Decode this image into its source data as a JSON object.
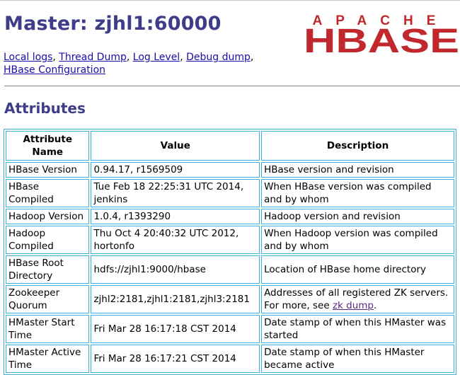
{
  "header": {
    "title": "Master: zjhl1:60000",
    "logo": {
      "top_text": "APACHE",
      "main_text": "HBASE"
    }
  },
  "nav_links": [
    "Local logs",
    "Thread Dump",
    "Log Level",
    "Debug dump",
    "HBase Configuration"
  ],
  "section": {
    "title": "Attributes"
  },
  "table": {
    "headers": [
      "Attribute Name",
      "Value",
      "Description"
    ],
    "rows": [
      [
        "HBase Version",
        "0.94.17, r1569509",
        "HBase version and revision"
      ],
      [
        "HBase Compiled",
        "Tue Feb 18 22:25:31 UTC 2014, jenkins",
        "When HBase version was compiled and by whom"
      ],
      [
        "Hadoop Version",
        "1.0.4, r1393290",
        "Hadoop version and revision"
      ],
      [
        "Hadoop Compiled",
        "Thu Oct 4 20:40:32 UTC 2012, hortonfo",
        "When Hadoop version was compiled and by whom"
      ],
      [
        "HBase Root Directory",
        "hdfs://zjhl1:9000/hbase",
        "Location of HBase home directory"
      ],
      [
        "Zookeeper Quorum",
        "zjhl2:2181,zjhl1:2181,zjhl3:2181",
        "Addresses of all registered ZK servers. For more, see "
      ],
      [
        "HMaster Start Time",
        "Fri Mar 28 16:17:18 CST 2014",
        "Date stamp of when this HMaster was started"
      ],
      [
        "HMaster Active Time",
        "Fri Mar 28 16:17:21 CST 2014",
        "Date stamp of when this HMaster became active"
      ]
    ],
    "zk_link": "zk dump",
    "zk_suffix": "."
  },
  "colors": {
    "heading": "#3f3c8a",
    "logo_red": "#c0282e",
    "table_border": "#3ab0dc"
  }
}
